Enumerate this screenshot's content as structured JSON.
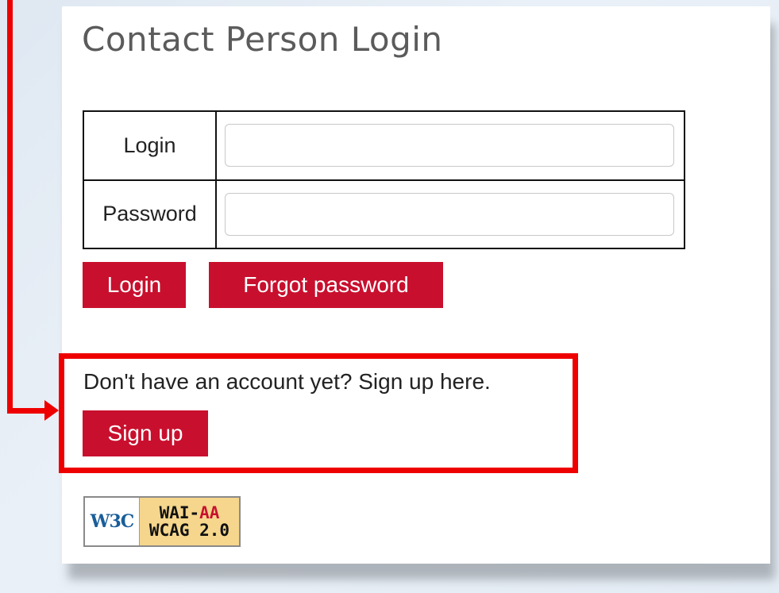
{
  "page": {
    "title": "Contact Person Login"
  },
  "form": {
    "login_label": "Login",
    "login_value": "",
    "password_label": "Password",
    "password_value": ""
  },
  "buttons": {
    "login": "Login",
    "forgot_password": "Forgot password",
    "sign_up": "Sign up"
  },
  "signup": {
    "prompt": "Don't have an account yet? Sign up here."
  },
  "badge": {
    "logo_text": "W3C",
    "line1_prefix": "WAI-",
    "line1_level": "AA",
    "line2": "WCAG 2.0"
  },
  "annotation": {
    "color": "#ee0000"
  },
  "colors": {
    "button_bg": "#c8102e",
    "button_text": "#ffffff",
    "title_text": "#5b5b5b"
  }
}
